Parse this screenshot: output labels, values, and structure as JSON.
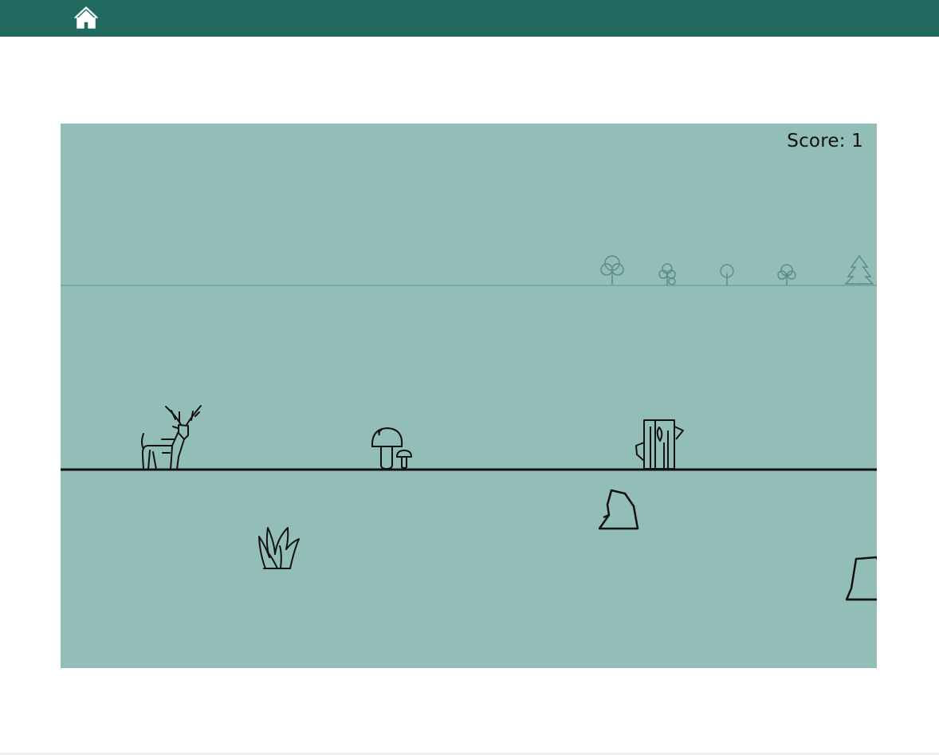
{
  "header": {
    "home_icon": "home-icon",
    "bar_color": "#226a5f"
  },
  "game": {
    "background_color": "#93beb7",
    "score_text": "Score: 1",
    "player": "deer",
    "foreground_items": [
      "mushroom-icon",
      "tree-stump-icon",
      "rock-icon",
      "grass-tuft-icon",
      "rock-icon"
    ],
    "background_items": [
      "tree-icon",
      "tree-icon",
      "tree-icon",
      "tree-icon",
      "pine-tree-icon"
    ]
  }
}
